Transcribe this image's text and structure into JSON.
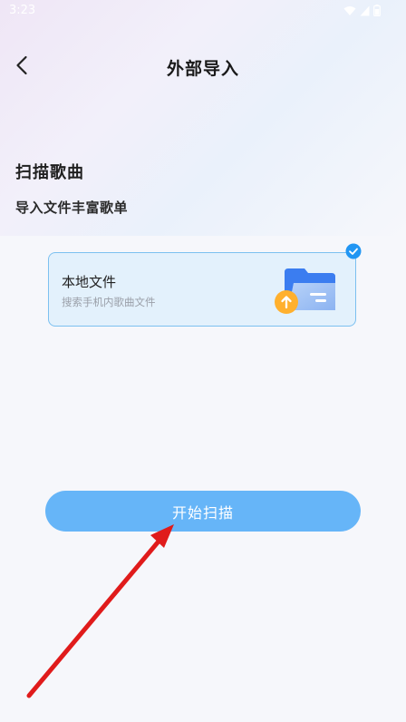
{
  "status_bar": {
    "time": "3:23",
    "icons": [
      "wifi-icon",
      "signal-icon",
      "battery-icon"
    ]
  },
  "header": {
    "back_icon": "chevron-left-icon",
    "title": "外部导入"
  },
  "section": {
    "title": "扫描歌曲",
    "subtitle": "导入文件丰富歌单"
  },
  "options": [
    {
      "title": "本地文件",
      "description": "搜索手机内歌曲文件",
      "selected": true,
      "icon": "folder-upload-icon"
    }
  ],
  "actions": {
    "start_label": "开始扫描"
  },
  "colors": {
    "accent": "#66b5f8",
    "card_border": "#7cc0f0",
    "card_bg": "#e3f1fc",
    "check": "#2196f3",
    "annotation_arrow": "#e01b1b"
  }
}
